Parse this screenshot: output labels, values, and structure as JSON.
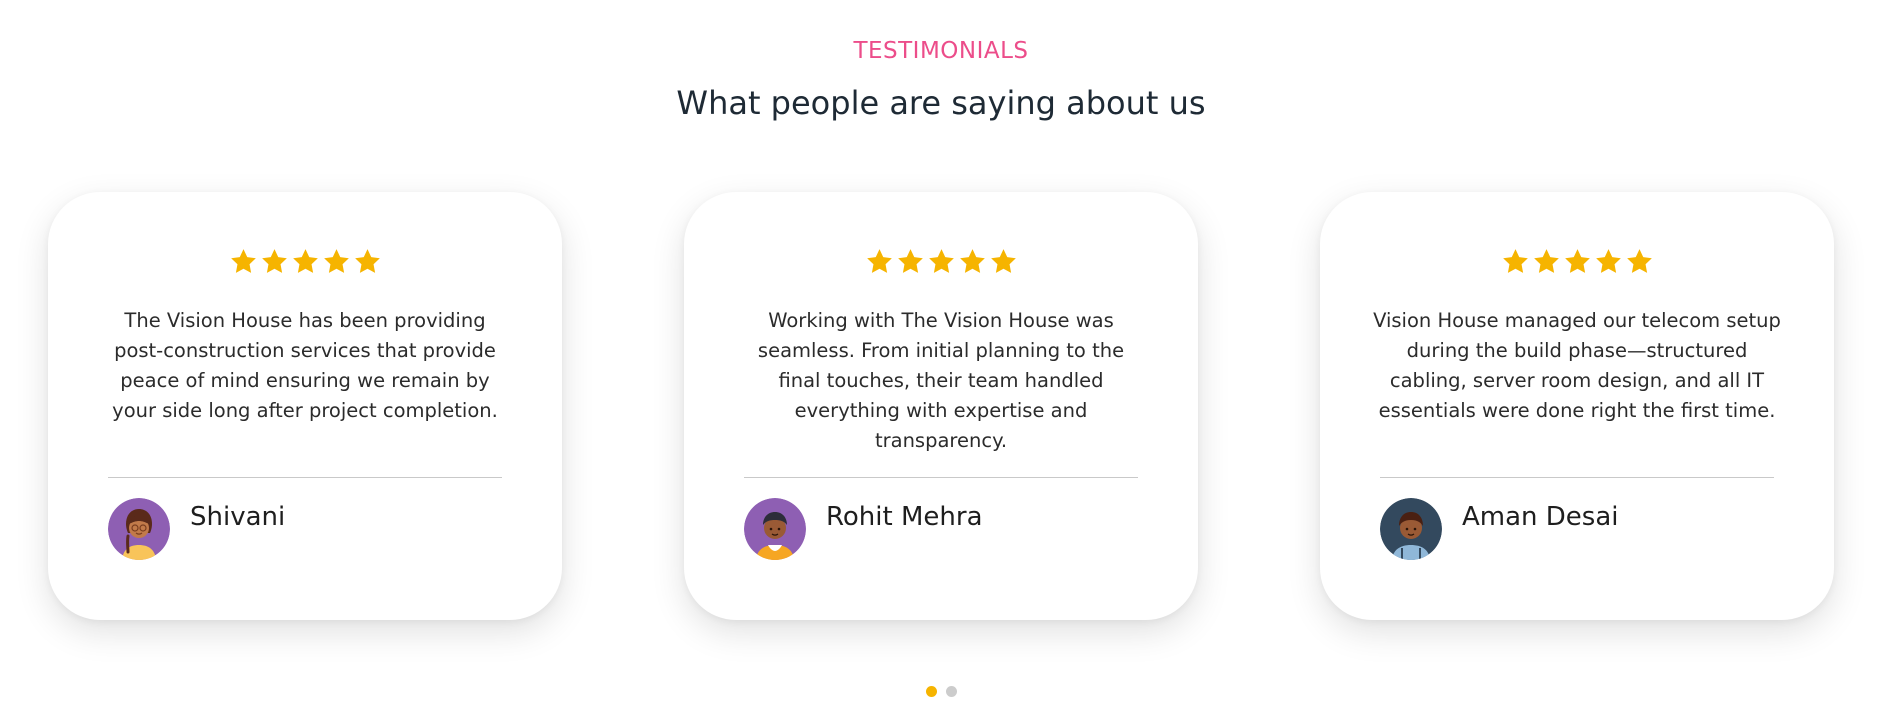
{
  "section": {
    "eyebrow": "TESTIMONIALS",
    "heading": "What people are saying about us"
  },
  "colors": {
    "eyebrow": "#ec4d8a",
    "star": "#f6b400",
    "dot_active": "#f6b400",
    "dot_inactive": "#cccccc"
  },
  "testimonials": [
    {
      "rating": 5,
      "quote": "The Vision House has been providing post-construction services that provide peace of mind ensuring we remain by your side long after project completion.",
      "name": "Shivani",
      "avatar_icon": "girl-avatar-icon"
    },
    {
      "rating": 5,
      "quote": "Working with The Vision House was seamless. From initial planning to the final touches, their team handled everything with expertise and transparency.",
      "name": "Rohit Mehra",
      "avatar_icon": "boy-avatar-icon"
    },
    {
      "rating": 5,
      "quote": "Vision House managed our telecom setup during the build phase—structured cabling, server room design, and all IT essentials were done right the first time.",
      "name": "Aman Desai",
      "avatar_icon": "boy-avatar-icon"
    }
  ],
  "carousel": {
    "total_pages": 2,
    "active_page": 1
  }
}
